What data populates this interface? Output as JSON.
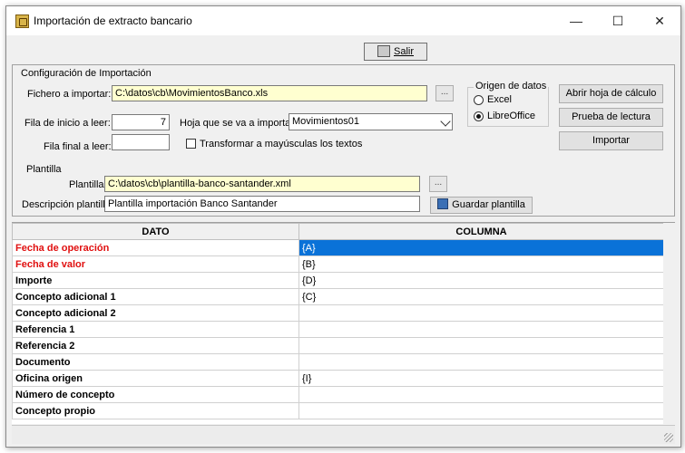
{
  "window": {
    "title": "Importación de extracto bancario",
    "controls": {
      "minimize": "—",
      "maximize": "☐",
      "close": "✕"
    }
  },
  "toolbar": {
    "salir_label": "Salir"
  },
  "config": {
    "group_title": "Configuración de Importación",
    "fichero_label": "Fichero a importar:",
    "fichero_value": "C:\\datos\\cb\\MovimientosBanco.xls",
    "browse_label": "...",
    "fila_inicio_label": "Fila de inicio a leer:",
    "fila_inicio_value": "7",
    "fila_final_label": "Fila final a leer:",
    "fila_final_value": "",
    "hoja_label": "Hoja que se va a importar",
    "hoja_value": "Movimientos01",
    "transformar_label": "Transformar a mayúsculas los textos",
    "transformar_checked": false
  },
  "origen": {
    "title": "Origen de datos",
    "options": [
      "Excel",
      "LibreOffice"
    ],
    "selected": "LibreOffice"
  },
  "buttons": {
    "abrir_hoja": "Abrir hoja de cálculo",
    "prueba_lectura": "Prueba de lectura",
    "importar": "Importar"
  },
  "plantilla": {
    "group_title": "Plantilla",
    "plantilla_label": "Plantilla:",
    "plantilla_value": "C:\\datos\\cb\\plantilla-banco-santander.xml",
    "browse_label": "...",
    "descripcion_label": "Descripción plantilla",
    "descripcion_value": "Plantilla importación Banco Santander",
    "guardar_label": "Guardar plantilla"
  },
  "grid": {
    "headers": [
      "DATO",
      "COLUMNA"
    ],
    "rows": [
      {
        "dato": "Fecha de operación",
        "columna": "{A}"
      },
      {
        "dato": "Fecha de valor",
        "columna": "{B}"
      },
      {
        "dato": "Importe",
        "columna": "{D}"
      },
      {
        "dato": "Concepto adicional 1",
        "columna": "{C}"
      },
      {
        "dato": "Concepto adicional 2",
        "columna": ""
      },
      {
        "dato": "Referencia 1",
        "columna": ""
      },
      {
        "dato": "Referencia 2",
        "columna": ""
      },
      {
        "dato": "Documento",
        "columna": ""
      },
      {
        "dato": "Oficina origen",
        "columna": "{I}"
      },
      {
        "dato": "Número de concepto",
        "columna": ""
      },
      {
        "dato": "Concepto propio",
        "columna": ""
      }
    ],
    "required_rows": [
      0,
      1
    ],
    "selected_row": 0
  },
  "colors": {
    "required_text": "#e01010",
    "selection": "#0a72d8",
    "input_yellow": "#ffffd0"
  }
}
